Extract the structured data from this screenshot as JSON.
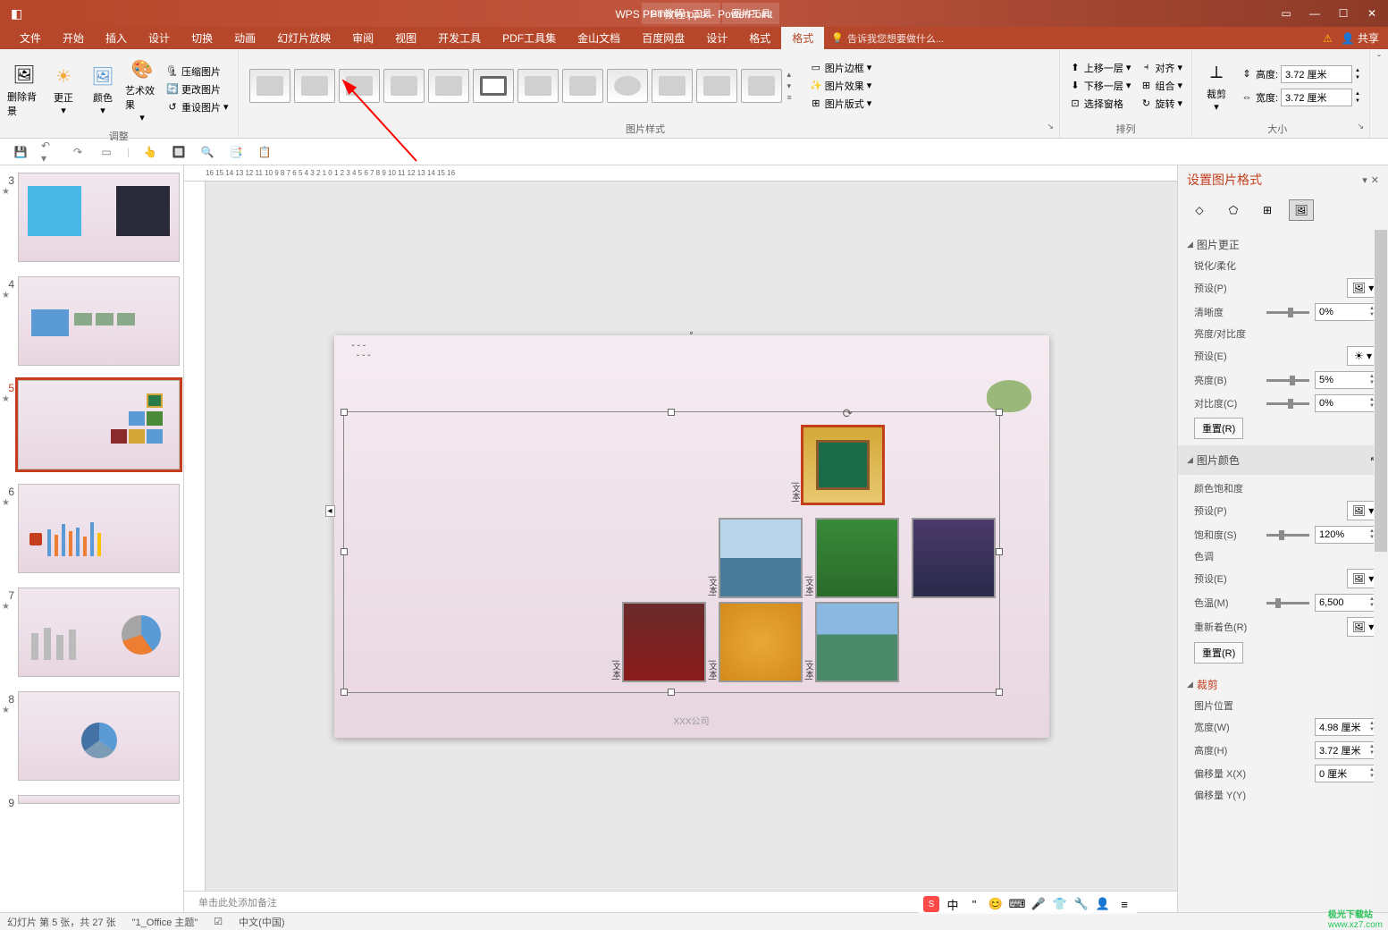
{
  "title": "WPS PPT教程.pptx - PowerPoint",
  "context_tabs": [
    "SmartArt 工具",
    "图片工具"
  ],
  "menu": [
    "文件",
    "开始",
    "插入",
    "设计",
    "切换",
    "动画",
    "幻灯片放映",
    "审阅",
    "视图",
    "开发工具",
    "PDF工具集",
    "金山文档",
    "百度网盘",
    "设计",
    "格式",
    "格式"
  ],
  "tell_me": "告诉我您想要做什么...",
  "share": "共享",
  "ribbon": {
    "remove_bg": "删除背景",
    "corrections": "更正",
    "color": "颜色",
    "artistic": "艺术效果",
    "compress": "压缩图片",
    "change": "更改图片",
    "reset": "重设图片",
    "group_adjust": "调整",
    "group_style": "图片样式",
    "border": "图片边框",
    "effects": "图片效果",
    "layout": "图片版式",
    "forward": "上移一层",
    "backward": "下移一层",
    "selection_pane": "选择窗格",
    "align": "对齐",
    "group": "组合",
    "rotate": "旋转",
    "group_arrange": "排列",
    "crop": "裁剪",
    "height_label": "高度:",
    "width_label": "宽度:",
    "height_val": "3.72 厘米",
    "width_val": "3.72 厘米",
    "group_size": "大小"
  },
  "pane": {
    "title": "设置图片格式",
    "pic_correct": "图片更正",
    "sharpen_soften": "锐化/柔化",
    "preset_p": "预设(P)",
    "sharpness": "清晰度",
    "sharpness_val": "0%",
    "bright_contrast": "亮度/对比度",
    "preset_e": "预设(E)",
    "brightness": "亮度(B)",
    "brightness_val": "5%",
    "contrast": "对比度(C)",
    "contrast_val": "0%",
    "reset_r": "重置(R)",
    "pic_color": "图片颜色",
    "saturation": "颜色饱和度",
    "saturation_s": "饱和度(S)",
    "saturation_val": "120%",
    "tone": "色调",
    "temp": "色温(M)",
    "temp_val": "6,500",
    "recolor": "重新着色(R)",
    "crop": "裁剪",
    "pic_position": "图片位置",
    "width_w": "宽度(W)",
    "width_w_val": "4.98 厘米",
    "height_h": "高度(H)",
    "height_h_val": "3.72 厘米",
    "offset_x": "偏移量 X(X)",
    "offset_x_val": "0 厘米",
    "offset_y": "偏移量 Y(Y)"
  },
  "notes": "单击此处添加备注",
  "status": {
    "slide_info": "幻灯片 第 5 张，共 27 张",
    "theme": "\"1_Office 主题\"",
    "lang": "中文(中国)"
  },
  "slide": {
    "company": "XXX公司"
  },
  "watermark": {
    "l1": "极光下载站",
    "l2": "www.xz7.com"
  }
}
